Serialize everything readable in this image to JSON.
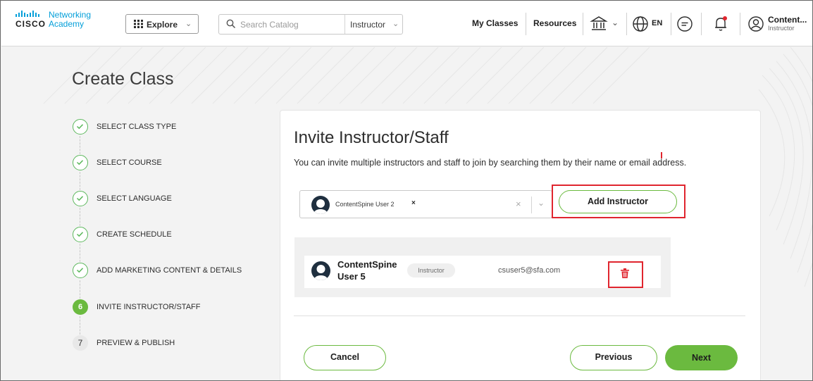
{
  "header": {
    "logo_bars": "·ı|ı·ı|ı·",
    "logo_wordmark": "CISCO",
    "logo_line1": "Networking",
    "logo_line2": "Academy",
    "explore_label": "Explore",
    "search_placeholder": "Search Catalog",
    "role_select": "Instructor",
    "my_classes": "My Classes",
    "resources": "Resources",
    "language": "EN",
    "user_name": "Content...",
    "user_role": "Instructor"
  },
  "page": {
    "title": "Create Class"
  },
  "steps": [
    {
      "label": "SELECT CLASS TYPE",
      "state": "done",
      "marker": ""
    },
    {
      "label": "SELECT COURSE",
      "state": "done",
      "marker": ""
    },
    {
      "label": "SELECT LANGUAGE",
      "state": "done",
      "marker": ""
    },
    {
      "label": "CREATE SCHEDULE",
      "state": "done",
      "marker": ""
    },
    {
      "label": "ADD MARKETING CONTENT & DETAILS",
      "state": "done",
      "marker": ""
    },
    {
      "label": "INVITE INSTRUCTOR/STAFF",
      "state": "active",
      "marker": "6"
    },
    {
      "label": "PREVIEW & PUBLISH",
      "state": "todo",
      "marker": "7"
    }
  ],
  "invite": {
    "title": "Invite Instructor/Staff",
    "description": "You can invite multiple instructors and staff to join by searching them by their name or email address.",
    "selected_chip": "ContentSpine User 2",
    "chip_remove": "×",
    "clear": "×",
    "add_button": "Add Instructor",
    "members": [
      {
        "name": "ContentSpine User 5",
        "role": "Instructor",
        "email": "csuser5@sfa.com"
      }
    ]
  },
  "footer": {
    "cancel": "Cancel",
    "previous": "Previous",
    "next": "Next"
  },
  "colors": {
    "accent_green": "#6bba3f",
    "highlight_red": "#e0252e",
    "brand_blue": "#049fd9"
  }
}
